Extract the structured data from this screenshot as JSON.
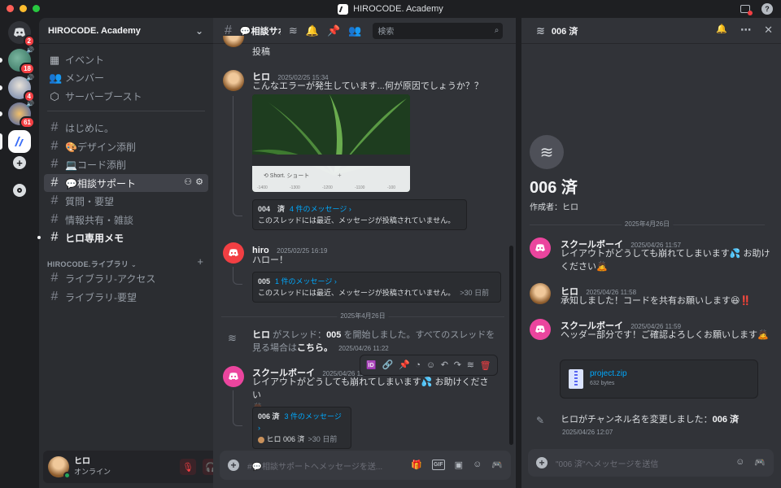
{
  "app": {
    "title": "HIROCODE. Academy"
  },
  "servers": [
    {
      "name": "dm-home",
      "badge": "2"
    },
    {
      "name": "server-1",
      "badge": "18"
    },
    {
      "name": "server-2",
      "badge": "4"
    },
    {
      "name": "server-3",
      "badge": "61"
    },
    {
      "name": "hirocode-academy",
      "badge": ""
    }
  ],
  "sidebar": {
    "guild_name": "HIROCODE. Academy",
    "top_items": [
      {
        "label": "イベント",
        "icon": "calendar-icon"
      },
      {
        "label": "メンバー",
        "icon": "members-icon"
      },
      {
        "label": "サーバーブースト",
        "icon": "boost-icon"
      }
    ],
    "channels": [
      {
        "label": "はじめに。",
        "state": "normal"
      },
      {
        "label": "🎨デザイン添削",
        "state": "normal"
      },
      {
        "label": "💻コード添削",
        "state": "normal"
      },
      {
        "label": "💬相談サポート",
        "state": "active"
      },
      {
        "label": "質問・要望",
        "state": "normal"
      },
      {
        "label": "情報共有・雑談",
        "state": "normal"
      },
      {
        "label": "ヒロ専用メモ",
        "state": "bold"
      }
    ],
    "category": "HIROCODE.ライブラリ",
    "library_channels": [
      {
        "label": "ライブラリ-アクセス"
      },
      {
        "label": "ライブラリ-要望"
      }
    ]
  },
  "user_panel": {
    "name": "ヒロ",
    "status": "オンライン"
  },
  "chat": {
    "channel_name": "💬相談サポート",
    "search_placeholder": "検索",
    "messages": [
      {
        "tail": "投稿"
      },
      {
        "author": "ヒロ",
        "time": "2025/02/25 15:34",
        "text": "こんなエラーが発生しています...何が原因でしょうか？？",
        "screenshot": {
          "toolbar": "Short. ショート",
          "ruler": [
            "-1400",
            "-1300",
            "-1200",
            "-1100",
            "-100"
          ]
        },
        "thread": {
          "name": "004　済",
          "count": "4 件のメッセージ ›",
          "preview": "このスレッドには最近、メッセージが投稿されていません。"
        }
      },
      {
        "author": "hiro",
        "time": "2025/02/25 16:19",
        "text": "ハロー！",
        "thread": {
          "name": "005",
          "count": "1 件のメッセージ ›",
          "preview": "このスレッドには最近、メッセージが投稿されていません。",
          "ago": ">30 日前"
        }
      },
      {
        "system_author": "ヒロ",
        "system_text_1": "がスレッド：",
        "thread_name": "005",
        "system_text_2": "を開始しました。すべてのスレッドを",
        "system_text_3": "見る場合は",
        "system_link": "こちら。",
        "time": "2025/04/26 11:22"
      },
      {
        "author": "スクールボーイ",
        "time": "2025/04/26 11:...",
        "text": "レイアウトがどうしても崩れてしまいます💦 お助けください",
        "emoji": "🙇",
        "thread": {
          "name": "006 済",
          "count": "3 件のメッセージ ›",
          "preview": "ヒロ 006 済",
          "ago": ">30 日前"
        }
      }
    ],
    "date_divider": "2025年4月26日",
    "composer_placeholder": "#💬相談サポートへメッセージを送..."
  },
  "thread_panel": {
    "title": "006 済",
    "big_title": "006 済",
    "created_by": "作成者：ヒロ",
    "date_divider": "2025年4月26日",
    "messages": [
      {
        "author": "スクールボーイ",
        "time": "2025/04/26 11:57",
        "text": "レイアウトがどうしても崩れてしまいます💦 お助けください🙇"
      },
      {
        "author": "ヒロ",
        "time": "2025/04/26 11:58",
        "text": "承知しました！コードを共有お願いします😆‼️"
      },
      {
        "author": "スクールボーイ",
        "time": "2025/04/26 11:59",
        "text": "ヘッダー部分です！ご確認よろしくお願いします🙇"
      }
    ],
    "file": {
      "name": "project.zip",
      "size": "632 bytes"
    },
    "system": {
      "text": "ヒロがチャンネル名を変更しました：",
      "bold": "006 済",
      "time": "2025/04/26 12:07"
    },
    "composer_placeholder": "\"006 済\"へメッセージを送信"
  },
  "colors": {
    "accent": "#5865f2",
    "mention": "#00a8fc",
    "danger": "#f23f43",
    "online": "#23a55a"
  }
}
